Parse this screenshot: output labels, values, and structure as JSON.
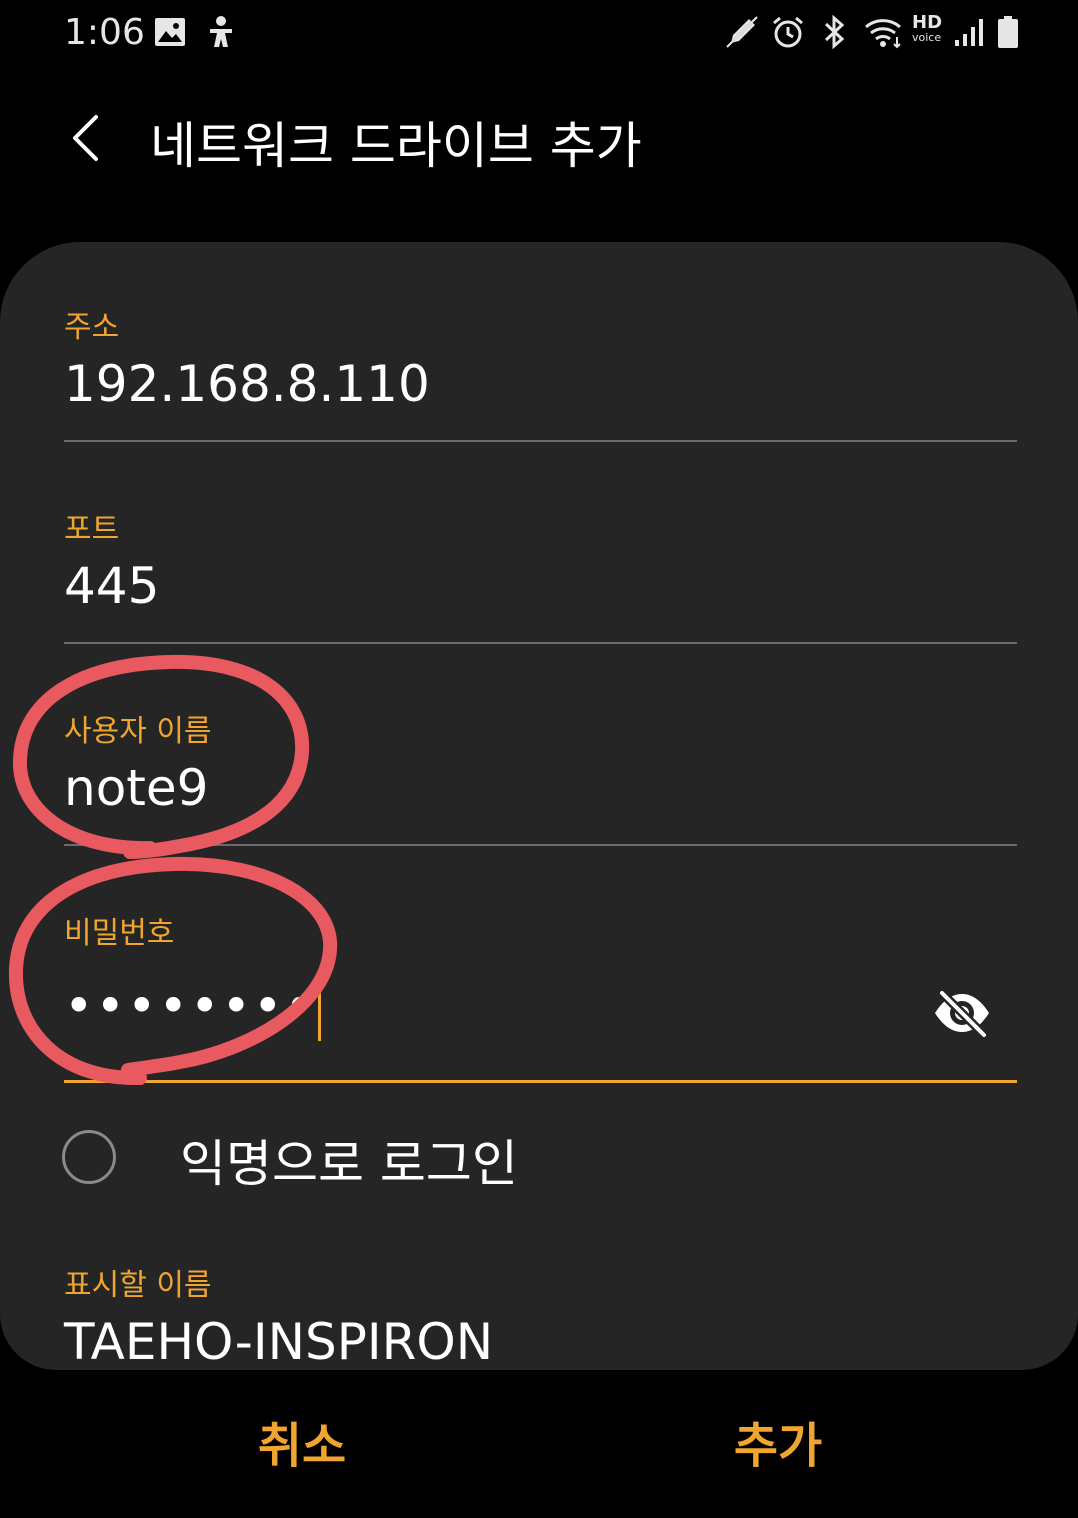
{
  "status_bar": {
    "time": "1:06",
    "left_icons": [
      "gallery-icon",
      "accessibility-icon"
    ],
    "right_icons": [
      "pen-icon",
      "alarm-icon",
      "bluetooth-icon",
      "wifi-icon",
      "signal-icon",
      "battery-icon"
    ],
    "hd_voice": {
      "hd": "HD",
      "voice": "voice"
    }
  },
  "app_bar": {
    "title": "네트워크 드라이브 추가",
    "back_icon": "chevron-left-icon"
  },
  "form": {
    "address": {
      "label": "주소",
      "value": "192.168.8.110"
    },
    "port": {
      "label": "포트",
      "value": "445"
    },
    "username": {
      "label": "사용자 이름",
      "value": "note9"
    },
    "password": {
      "label": "비밀번호",
      "value": "••••••••",
      "toggle_icon": "eye-off-icon"
    },
    "anonymous": {
      "label": "익명으로 로그인",
      "checked": false
    },
    "display_name": {
      "label": "표시할 이름",
      "value": "TAEHO-INSPIRON"
    }
  },
  "buttons": {
    "cancel": "취소",
    "add": "추가"
  },
  "colors": {
    "accent": "#f0a531",
    "card": "#252525",
    "background": "#000000",
    "annotation": "#e85a5f"
  }
}
